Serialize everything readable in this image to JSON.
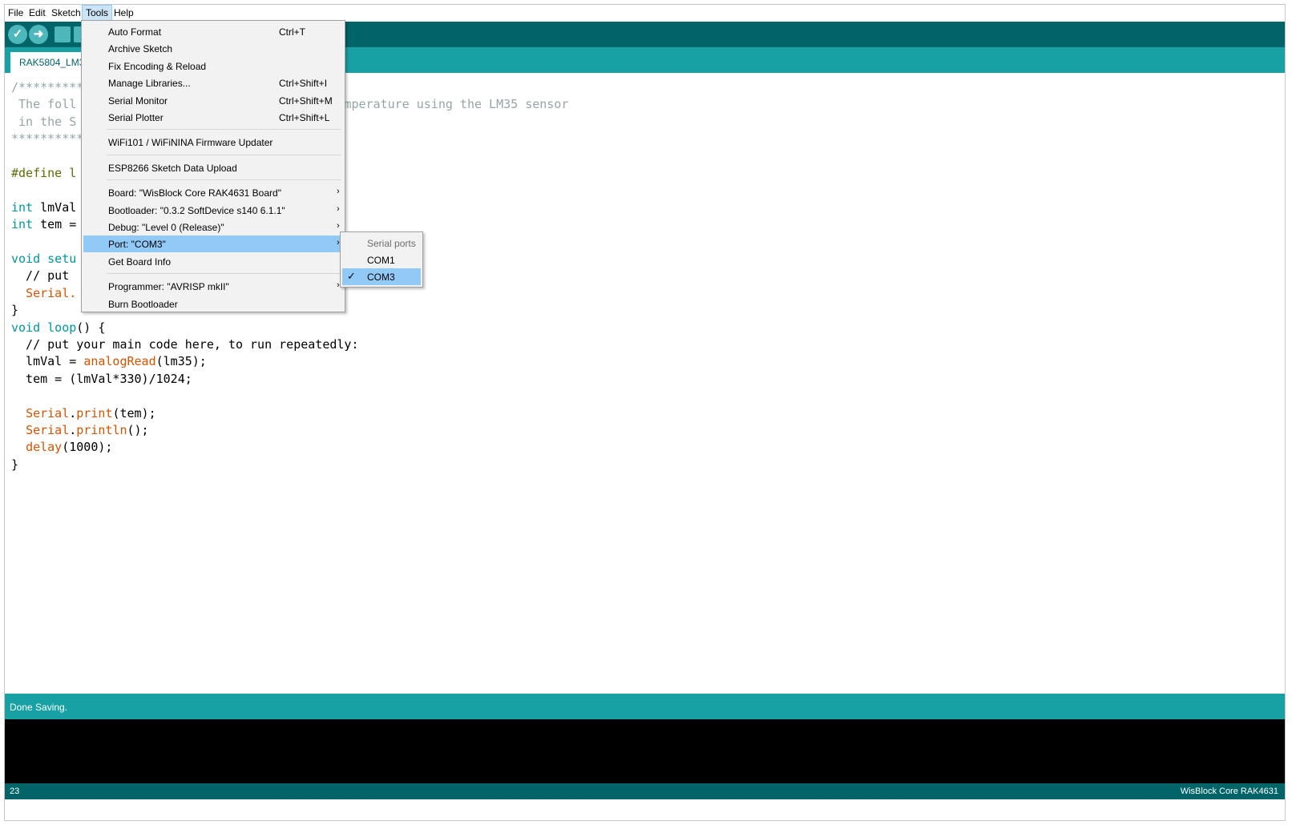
{
  "menubar": [
    "File",
    "Edit",
    "Sketch",
    "Tools",
    "Help"
  ],
  "tab": {
    "label": "RAK5804_LM35"
  },
  "code_lines": [
    [
      {
        "t": "/**********",
        "c": "cmt"
      }
    ],
    [
      {
        "t": " The foll",
        "c": "cmt"
      },
      {
        "t": "                                 ",
        "c": ""
      },
      {
        "t": "t temperature using the LM35 sensor",
        "c": "cmt"
      }
    ],
    [
      {
        "t": " in the S",
        "c": "cmt"
      }
    ],
    [
      {
        "t": "**********",
        "c": "cmt"
      }
    ],
    [],
    [
      {
        "t": "#define l",
        "c": "pp"
      }
    ],
    [],
    [
      {
        "t": "int",
        "c": "kw"
      },
      {
        "t": " lmVal",
        "c": ""
      }
    ],
    [
      {
        "t": "int",
        "c": "kw"
      },
      {
        "t": " tem = ",
        "c": ""
      }
    ],
    [],
    [
      {
        "t": "void",
        "c": "kw"
      },
      {
        "t": " ",
        "c": ""
      },
      {
        "t": "setu",
        "c": "kw"
      }
    ],
    [
      {
        "t": "  // put",
        "c": ""
      }
    ],
    [
      {
        "t": "  ",
        "c": ""
      },
      {
        "t": "Serial.",
        "c": "fn"
      }
    ],
    [
      {
        "t": "}",
        "c": ""
      }
    ],
    [
      {
        "t": "void",
        "c": "kw"
      },
      {
        "t": " ",
        "c": ""
      },
      {
        "t": "loop",
        "c": "kw"
      },
      {
        "t": "() {",
        "c": ""
      }
    ],
    [
      {
        "t": "  // put your main code here, to run repeatedly:",
        "c": ""
      }
    ],
    [
      {
        "t": "  lmVal = ",
        "c": ""
      },
      {
        "t": "analogRead",
        "c": "fn"
      },
      {
        "t": "(lm35);",
        "c": ""
      }
    ],
    [
      {
        "t": "  tem = (lmVal*330)/1024;",
        "c": ""
      }
    ],
    [],
    [
      {
        "t": "  ",
        "c": ""
      },
      {
        "t": "Serial",
        "c": "fn"
      },
      {
        "t": ".",
        "c": ""
      },
      {
        "t": "print",
        "c": "fn"
      },
      {
        "t": "(tem);",
        "c": ""
      }
    ],
    [
      {
        "t": "  ",
        "c": ""
      },
      {
        "t": "Serial",
        "c": "fn"
      },
      {
        "t": ".",
        "c": ""
      },
      {
        "t": "println",
        "c": "fn"
      },
      {
        "t": "();",
        "c": ""
      }
    ],
    [
      {
        "t": "  ",
        "c": ""
      },
      {
        "t": "delay",
        "c": "fn"
      },
      {
        "t": "(1000);",
        "c": ""
      }
    ],
    [
      {
        "t": "}",
        "c": ""
      }
    ]
  ],
  "tools_menu": {
    "items": [
      {
        "label": "Auto Format",
        "shortcut": "Ctrl+T"
      },
      {
        "label": "Archive Sketch",
        "shortcut": ""
      },
      {
        "label": "Fix Encoding & Reload",
        "shortcut": ""
      },
      {
        "label": "Manage Libraries...",
        "shortcut": "Ctrl+Shift+I"
      },
      {
        "label": "Serial Monitor",
        "shortcut": "Ctrl+Shift+M"
      },
      {
        "label": "Serial Plotter",
        "shortcut": "Ctrl+Shift+L"
      },
      {
        "sep": true
      },
      {
        "label": "WiFi101 / WiFiNINA Firmware Updater",
        "shortcut": ""
      },
      {
        "sep": true
      },
      {
        "label": "ESP8266 Sketch Data Upload",
        "shortcut": ""
      },
      {
        "sep": true
      },
      {
        "label": "Board: \"WisBlock Core RAK4631 Board\"",
        "submenu": true
      },
      {
        "label": "Bootloader: \"0.3.2 SoftDevice s140 6.1.1\"",
        "submenu": true
      },
      {
        "label": "Debug: \"Level 0 (Release)\"",
        "submenu": true
      },
      {
        "label": "Port: \"COM3\"",
        "submenu": true,
        "highlighted": true
      },
      {
        "label": "Get Board Info",
        "shortcut": ""
      },
      {
        "sep": true
      },
      {
        "label": "Programmer: \"AVRISP mkII\"",
        "submenu": true
      },
      {
        "label": "Burn Bootloader",
        "shortcut": ""
      }
    ]
  },
  "port_submenu": {
    "header": "Serial ports",
    "items": [
      {
        "label": "COM1",
        "checked": false
      },
      {
        "label": "COM3",
        "checked": true
      }
    ]
  },
  "status": {
    "message": "Done Saving."
  },
  "footer": {
    "line": "23",
    "board": "WisBlock Core RAK4631"
  },
  "icons": [
    "verify-icon",
    "upload-icon",
    "new-sketch-icon",
    "open-sketch-icon"
  ]
}
